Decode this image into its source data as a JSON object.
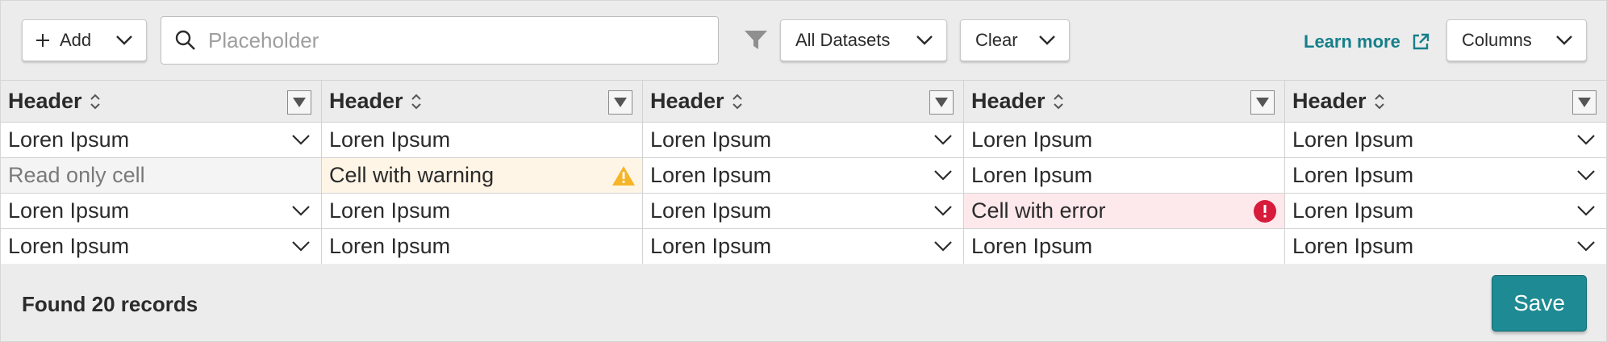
{
  "toolbar": {
    "add_label": "Add",
    "search_placeholder": "Placeholder",
    "datasets_label": "All Datasets",
    "clear_label": "Clear",
    "learn_more_label": "Learn more",
    "columns_label": "Columns"
  },
  "table": {
    "headers": [
      "Header",
      "Header",
      "Header",
      "Header",
      "Header"
    ],
    "rows": [
      [
        "Loren Ipsum",
        "Loren Ipsum",
        "Loren Ipsum",
        "Loren Ipsum",
        "Loren Ipsum"
      ],
      [
        "Read only cell",
        "Cell with warning",
        "Loren Ipsum",
        "Loren Ipsum",
        "Loren Ipsum"
      ],
      [
        "Loren Ipsum",
        "Loren Ipsum",
        "Loren Ipsum",
        "Cell with error",
        "Loren Ipsum"
      ],
      [
        "Loren Ipsum",
        "Loren Ipsum",
        "Loren Ipsum",
        "Loren Ipsum",
        "Loren Ipsum"
      ]
    ]
  },
  "footer": {
    "records_text": "Found 20 records",
    "save_label": "Save"
  },
  "colors": {
    "accent": "#1e8a93",
    "link": "#157f8a",
    "warning": "#f5b526",
    "error": "#d71b3b"
  },
  "icons": [
    "plus-icon",
    "chevron-down-icon",
    "search-icon",
    "filter-icon",
    "external-link-icon",
    "sort-icon",
    "column-filter-icon",
    "warning-icon",
    "error-icon"
  ]
}
